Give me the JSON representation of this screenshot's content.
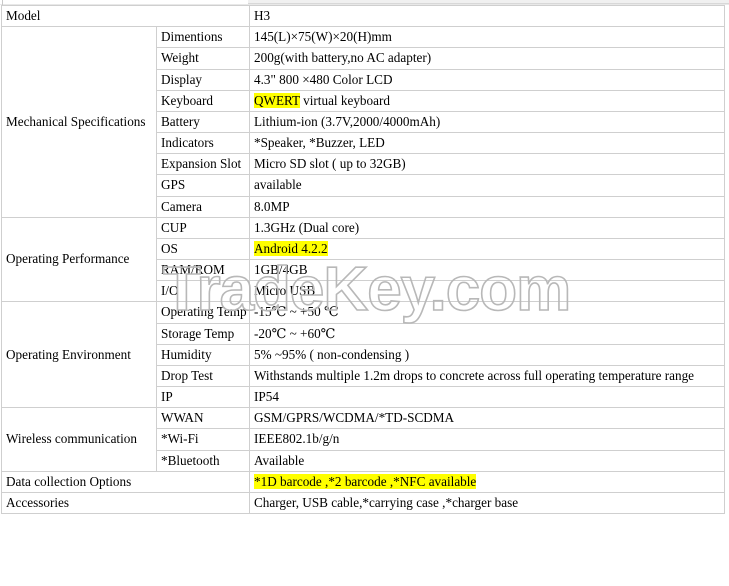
{
  "document": {
    "type": "product-specification-table",
    "watermark": {
      "text": "TradeKey.com",
      "color": "#b8b8b8"
    },
    "highlight_color": "#ffff00",
    "border_color": "#cfcfcf"
  },
  "rows": [
    {
      "group": "",
      "group_rowspan": 0,
      "label": "Model",
      "label_span": 2,
      "value": "H3",
      "highlight": false
    },
    {
      "group": "Mechanical Specifications",
      "group_rowspan": 9,
      "label": "Dimentions",
      "value": "145(L)×75(W)×20(H)mm",
      "highlight": false
    },
    {
      "label": "Weight",
      "value": "200g(with battery,no AC adapter)",
      "highlight": false
    },
    {
      "label": "Display",
      "value": "4.3\" 800 ×480 Color LCD",
      "highlight": false
    },
    {
      "label": "Keyboard",
      "value_highlighted": "QWERT",
      "value_rest": " virtual keyboard",
      "highlight": "partial"
    },
    {
      "label": "Battery",
      "value": "Lithium-ion (3.7V,2000/4000mAh)",
      "highlight": false
    },
    {
      "label": "Indicators",
      "value": "*Speaker, *Buzzer, LED",
      "highlight": false
    },
    {
      "label": "Expansion Slot",
      "value": "Micro SD slot ( up to 32GB)",
      "highlight": false
    },
    {
      "label": "GPS",
      "value": "available",
      "highlight": false
    },
    {
      "label": "Camera",
      "value": "8.0MP",
      "highlight": false
    },
    {
      "group": "Operating Performance",
      "group_rowspan": 4,
      "label": "CUP",
      "value": "1.3GHz (Dual core)",
      "highlight": false
    },
    {
      "label": "OS",
      "value": "Android 4.2.2",
      "highlight": true
    },
    {
      "label": "RAM/ROM",
      "value": "1GB/4GB",
      "highlight": false
    },
    {
      "label": "I/O",
      "value": "Micro USB",
      "highlight": false
    },
    {
      "group": "Operating Environment",
      "group_rowspan": 5,
      "label": "Operating Temp",
      "value": "-15℃ ~ +50 ℃",
      "highlight": false
    },
    {
      "label": "Storage Temp",
      "value": "-20℃ ~ +60℃",
      "highlight": false
    },
    {
      "label": "Humidity",
      "value": "5% ~95% ( non-condensing )",
      "highlight": false
    },
    {
      "label": "Drop Test",
      "value": "Withstands multiple 1.2m drops to concrete across full operating temperature range",
      "highlight": false
    },
    {
      "label": "IP",
      "value": "IP54",
      "highlight": false
    },
    {
      "group": "Wireless communication",
      "group_rowspan": 3,
      "label": "WWAN",
      "value": "GSM/GPRS/WCDMA/*TD-SCDMA",
      "highlight": false
    },
    {
      "label": "*Wi-Fi",
      "value": "IEEE802.1b/g/n",
      "highlight": false
    },
    {
      "label": "*Bluetooth",
      "value": "Available",
      "highlight": false
    },
    {
      "group": "",
      "label": "Data collection Options",
      "label_span": 2,
      "value": "*1D barcode ,*2 barcode ,*NFC available",
      "highlight": true
    },
    {
      "group": "",
      "label": "Accessories",
      "label_span": 2,
      "value": "Charger, USB cable,*carrying case ,*charger base",
      "highlight": false
    }
  ]
}
